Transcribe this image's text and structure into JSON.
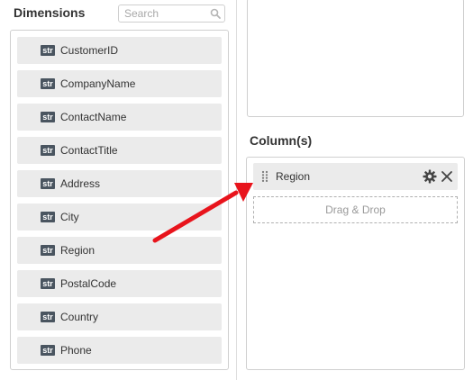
{
  "dimensions": {
    "title": "Dimensions",
    "search_placeholder": "Search",
    "items": [
      {
        "type": "str",
        "label": "CustomerID"
      },
      {
        "type": "str",
        "label": "CompanyName"
      },
      {
        "type": "str",
        "label": "ContactName"
      },
      {
        "type": "str",
        "label": "ContactTitle"
      },
      {
        "type": "str",
        "label": "Address"
      },
      {
        "type": "str",
        "label": "City"
      },
      {
        "type": "str",
        "label": "Region"
      },
      {
        "type": "str",
        "label": "PostalCode"
      },
      {
        "type": "str",
        "label": "Country"
      },
      {
        "type": "str",
        "label": "Phone"
      }
    ]
  },
  "columns": {
    "title": "Column(s)",
    "items": [
      {
        "label": "Region"
      }
    ],
    "drop_hint": "Drag & Drop"
  },
  "colors": {
    "arrow": "#e8141c",
    "badge": "#4a5560",
    "item_bg": "#ebebeb"
  },
  "icons": [
    "search-icon",
    "drag-handle-icon",
    "gear-icon",
    "close-icon",
    "red-arrow"
  ]
}
